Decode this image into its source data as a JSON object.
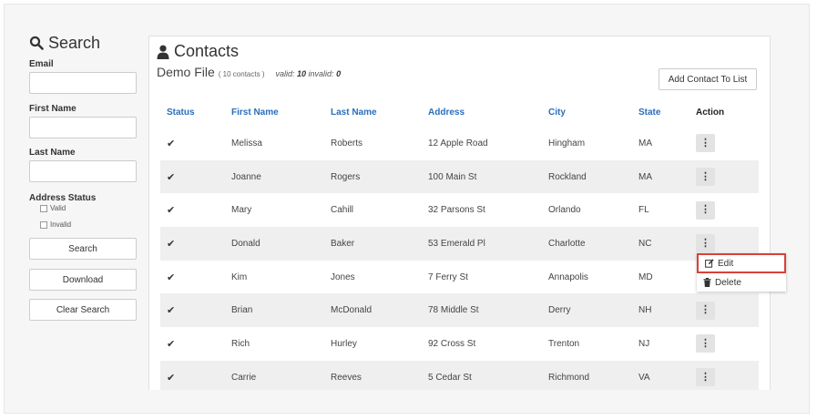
{
  "sidebar": {
    "title": "Search",
    "email_label": "Email",
    "first_name_label": "First Name",
    "last_name_label": "Last Name",
    "address_status_label": "Address Status",
    "valid_label": "Valid",
    "invalid_label": "Invalid",
    "search_button": "Search",
    "download_button": "Download",
    "clear_button": "Clear Search"
  },
  "panel": {
    "title": "Contacts",
    "file_name": "Demo File",
    "file_count": "( 10 contacts )",
    "valid_label": "valid:",
    "valid_count": "10",
    "invalid_label": "invalid:",
    "invalid_count": "0",
    "add_button": "Add Contact To List"
  },
  "table": {
    "columns": [
      "Status",
      "First Name",
      "Last Name",
      "Address",
      "City",
      "State",
      "Action"
    ],
    "rows": [
      {
        "first": "Melissa",
        "last": "Roberts",
        "address": "12 Apple Road",
        "city": "Hingham",
        "state": "MA"
      },
      {
        "first": "Joanne",
        "last": "Rogers",
        "address": "100 Main St",
        "city": "Rockland",
        "state": "MA"
      },
      {
        "first": "Mary",
        "last": "Cahill",
        "address": "32 Parsons St",
        "city": "Orlando",
        "state": "FL"
      },
      {
        "first": "Donald",
        "last": "Baker",
        "address": "53 Emerald Pl",
        "city": "Charlotte",
        "state": "NC"
      },
      {
        "first": "Kim",
        "last": "Jones",
        "address": "7 Ferry St",
        "city": "Annapolis",
        "state": "MD"
      },
      {
        "first": "Brian",
        "last": "McDonald",
        "address": "78 Middle St",
        "city": "Derry",
        "state": "NH"
      },
      {
        "first": "Rich",
        "last": "Hurley",
        "address": "92 Cross St",
        "city": "Trenton",
        "state": "NJ"
      },
      {
        "first": "Carrie",
        "last": "Reeves",
        "address": "5 Cedar St",
        "city": "Richmond",
        "state": "VA"
      }
    ]
  },
  "menu": {
    "edit_label": "Edit",
    "delete_label": "Delete"
  },
  "colors": {
    "header_blue": "#2a6ebb",
    "highlight_red": "#d9413b",
    "stripe": "#efefef"
  }
}
